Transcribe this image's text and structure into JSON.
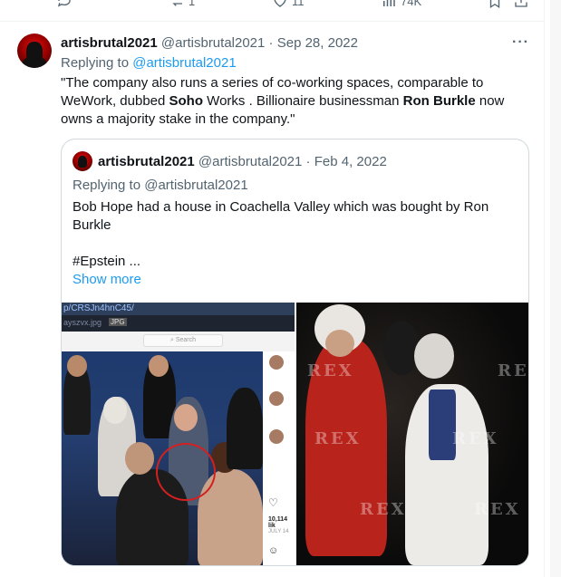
{
  "top_actions": {
    "retweets": "1",
    "likes": "11",
    "views": "74K"
  },
  "tweet": {
    "author_name": "artisbrutal2021",
    "author_handle": "@artisbrutal2021",
    "separator": "·",
    "date": "Sep 28, 2022",
    "replying_prefix": "Replying to",
    "replying_handle": "@artisbrutal2021",
    "text_part1": "\"The company also runs a series of co-working spaces, comparable to WeWork, dubbed ",
    "text_bold1": "Soho",
    "text_part2": " Works . Billionaire businessman ",
    "text_bold2": "Ron Burkle",
    "text_part3": " now owns a majority stake in the company.\"",
    "more_label": "···"
  },
  "quote": {
    "author_name": "artisbrutal2021",
    "author_handle": "@artisbrutal2021",
    "separator": "·",
    "date": "Feb 4, 2022",
    "replying": "Replying to @artisbrutal2021",
    "text": "Bob Hope had a house in Coachella Valley which was bought by Ron Burkle",
    "hashtag_line": "#Epstein  ...",
    "show_more": "Show more"
  },
  "photo1": {
    "url_fragment": "p/CRSJn4hnC45/",
    "file_fragment": "ayszvx.jpg",
    "file_ext": "JPG",
    "search_label": "Search",
    "likes_count": "10,114 lik",
    "date_label": "JULY 14"
  },
  "photo2": {
    "watermark": "REX"
  }
}
